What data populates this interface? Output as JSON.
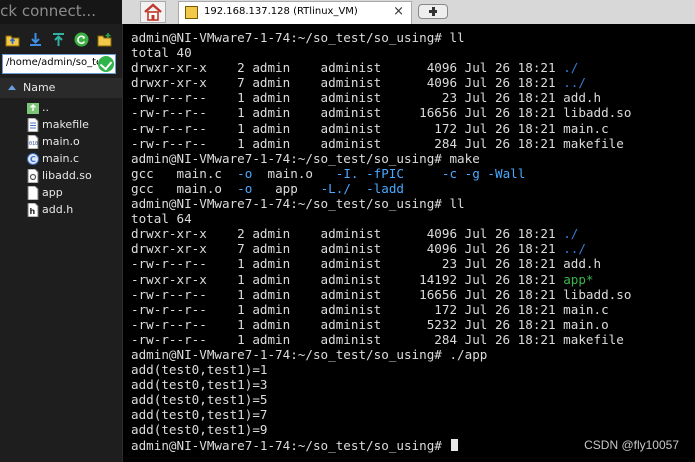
{
  "left_panel": {
    "quick_connect": "ick connect...",
    "path": "/home/admin/so_test/so_using",
    "column_header": "Name",
    "files": [
      {
        "name": "..",
        "icon": "parent-folder-icon"
      },
      {
        "name": "makefile",
        "icon": "text-file-icon"
      },
      {
        "name": "main.o",
        "icon": "binary-file-icon"
      },
      {
        "name": "main.c",
        "icon": "c-source-icon"
      },
      {
        "name": "libadd.so",
        "icon": "library-file-icon"
      },
      {
        "name": "app",
        "icon": "executable-file-icon"
      },
      {
        "name": "add.h",
        "icon": "header-file-icon"
      }
    ]
  },
  "tabs": {
    "active_title": "192.168.137.128 (RTlinux_VM)",
    "close_glyph": "×"
  },
  "terminal": {
    "lines": [
      [
        {
          "t": "admin@NI-VMware7-1-74:~/so_test/so_using# ll"
        }
      ],
      [
        {
          "t": "total 40"
        }
      ],
      [
        {
          "t": "drwxr-xr-x    2 admin    administ      4096 Jul 26 18:21 "
        },
        {
          "t": "./",
          "c": "cdir"
        }
      ],
      [
        {
          "t": "drwxr-xr-x    7 admin    administ      4096 Jul 26 18:21 "
        },
        {
          "t": "../",
          "c": "cdir"
        }
      ],
      [
        {
          "t": "-rw-r--r--    1 admin    administ        23 Jul 26 18:21 add.h"
        }
      ],
      [
        {
          "t": "-rw-r--r--    1 admin    administ     16656 Jul 26 18:21 libadd.so"
        }
      ],
      [
        {
          "t": "-rw-r--r--    1 admin    administ       172 Jul 26 18:21 main.c"
        }
      ],
      [
        {
          "t": "-rw-r--r--    1 admin    administ       284 Jul 26 18:21 makefile"
        }
      ],
      [
        {
          "t": "admin@NI-VMware7-1-74:~/so_test/so_using# make"
        }
      ],
      [
        {
          "t": "gcc   main.c  "
        },
        {
          "t": "-o",
          "c": "cflag"
        },
        {
          "t": "  main.o   "
        },
        {
          "t": "-I. -fPIC",
          "c": "cflag"
        },
        {
          "t": "     "
        },
        {
          "t": "-c -g -Wall",
          "c": "cflag"
        }
      ],
      [
        {
          "t": "gcc   main.o  "
        },
        {
          "t": "-o",
          "c": "cflag"
        },
        {
          "t": "   app   "
        },
        {
          "t": "-L./",
          "c": "cflag"
        },
        {
          "t": "  "
        },
        {
          "t": "-ladd",
          "c": "cflag"
        }
      ],
      [
        {
          "t": "admin@NI-VMware7-1-74:~/so_test/so_using# ll"
        }
      ],
      [
        {
          "t": "total 64"
        }
      ],
      [
        {
          "t": "drwxr-xr-x    2 admin    administ      4096 Jul 26 18:21 "
        },
        {
          "t": "./",
          "c": "cdir"
        }
      ],
      [
        {
          "t": "drwxr-xr-x    7 admin    administ      4096 Jul 26 18:21 "
        },
        {
          "t": "../",
          "c": "cdir"
        }
      ],
      [
        {
          "t": "-rw-r--r--    1 admin    administ        23 Jul 26 18:21 add.h"
        }
      ],
      [
        {
          "t": "-rwxr-xr-x    1 admin    administ     14192 Jul 26 18:21 "
        },
        {
          "t": "app*",
          "c": "cexe"
        }
      ],
      [
        {
          "t": "-rw-r--r--    1 admin    administ     16656 Jul 26 18:21 libadd.so"
        }
      ],
      [
        {
          "t": "-rw-r--r--    1 admin    administ       172 Jul 26 18:21 main.c"
        }
      ],
      [
        {
          "t": "-rw-r--r--    1 admin    administ      5232 Jul 26 18:21 main.o"
        }
      ],
      [
        {
          "t": "-rw-r--r--    1 admin    administ       284 Jul 26 18:21 makefile"
        }
      ],
      [
        {
          "t": "admin@NI-VMware7-1-74:~/so_test/so_using# ./app"
        }
      ],
      [
        {
          "t": "add(test0,test1)=1"
        }
      ],
      [
        {
          "t": "add(test0,test1)=3"
        }
      ],
      [
        {
          "t": "add(test0,test1)=5"
        }
      ],
      [
        {
          "t": "add(test0,test1)=7"
        }
      ],
      [
        {
          "t": "add(test0,test1)=9"
        }
      ],
      [
        {
          "t": "admin@NI-VMware7-1-74:~/so_test/so_using# "
        },
        {
          "cursor": true
        }
      ]
    ],
    "watermark": "CSDN @fly10057"
  },
  "colors": {
    "directory": "#3a7bd5",
    "executable": "#39b54a",
    "flag": "#49a8ff"
  }
}
